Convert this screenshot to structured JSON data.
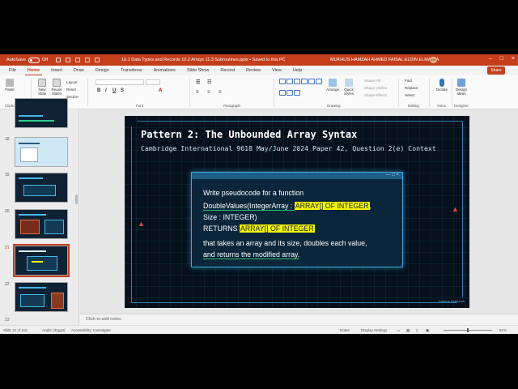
{
  "titlebar": {
    "autosave_label": "AutoSave",
    "autosave_state": "Off",
    "document_title": "10.1 Data Types and Records 10.2 Arrays 11.3 Subroutines.pptx • Saved to this PC",
    "user_name": "MUKHLIS HAMZAH AHMED FAISAL ELDIN ELMALLA",
    "user_initials": "MH"
  },
  "tabs": [
    {
      "label": "File",
      "key": "F"
    },
    {
      "label": "Home",
      "key": "H"
    },
    {
      "label": "Insert",
      "key": "N"
    },
    {
      "label": "Draw",
      "key": "JI"
    },
    {
      "label": "Design",
      "key": "G"
    },
    {
      "label": "Transitions",
      "key": "K"
    },
    {
      "label": "Animations",
      "key": "A"
    },
    {
      "label": "Slide Show",
      "key": "S"
    },
    {
      "label": "Record",
      "key": "C"
    },
    {
      "label": "Review",
      "key": "R"
    },
    {
      "label": "View",
      "key": "W"
    },
    {
      "label": "Help",
      "key": "Y2"
    }
  ],
  "share_label": "Share",
  "ribbon": {
    "paste": "Paste",
    "new_slide": "New Slide",
    "reuse_slides": "Reuse Slides",
    "layout": "Layout",
    "reset": "Reset",
    "section": "Section",
    "arrange": "Arrange",
    "quick_styles": "Quick Styles",
    "shape_fill": "Shape Fill",
    "shape_outline": "Shape Outline",
    "shape_effects": "Shape Effects",
    "find": "Find",
    "replace": "Replace",
    "select": "Select",
    "dictate": "Dictate",
    "design_ideas": "Design Ideas",
    "groups": {
      "clipboard": "Clipboard",
      "slides": "Slides",
      "font": "Font",
      "paragraph": "Paragraph",
      "drawing": "Drawing",
      "editing": "Editing",
      "voice": "Voice",
      "designer": "Designer"
    }
  },
  "thumbnails": [
    {
      "number": "",
      "selected": false
    },
    {
      "number": "18",
      "selected": false
    },
    {
      "number": "19",
      "selected": false
    },
    {
      "number": "20",
      "selected": false
    },
    {
      "number": "21",
      "selected": true
    },
    {
      "number": "22",
      "selected": false
    },
    {
      "number": "23",
      "selected": false
    }
  ],
  "slide": {
    "title": "Pattern 2: The Unbounded Array Syntax",
    "subtitle": "Cambridge International 9618 May/June 2024 Paper 42, Question 2(e) Context",
    "panel_controls": "— □ ×",
    "lines": [
      "Write pseudocode for a function",
      "DoubleValues(IntegerArray : ",
      "ARRAY[] OF INTEGER",
      ",",
      "Size : INTEGER)",
      "RETURNS ",
      "ARRAY[] OF INTEGER",
      "that takes an array and its size, doubles each value,",
      "and returns the modified array."
    ],
    "watermark": "Gamma Notebook"
  },
  "notes_placeholder": "Click to add notes",
  "status": {
    "slide_counter": "Slide 21 of 115",
    "language": "Arabic (Egypt)",
    "accessibility": "Accessibility: Investigate",
    "notes": "Notes",
    "display_settings": "Display Settings",
    "zoom": "61%"
  },
  "colors": {
    "accent": "#c43e1c",
    "slide_bg": "#06111d",
    "panel_border": "#3fa9e0",
    "highlight": "#f5f500"
  }
}
